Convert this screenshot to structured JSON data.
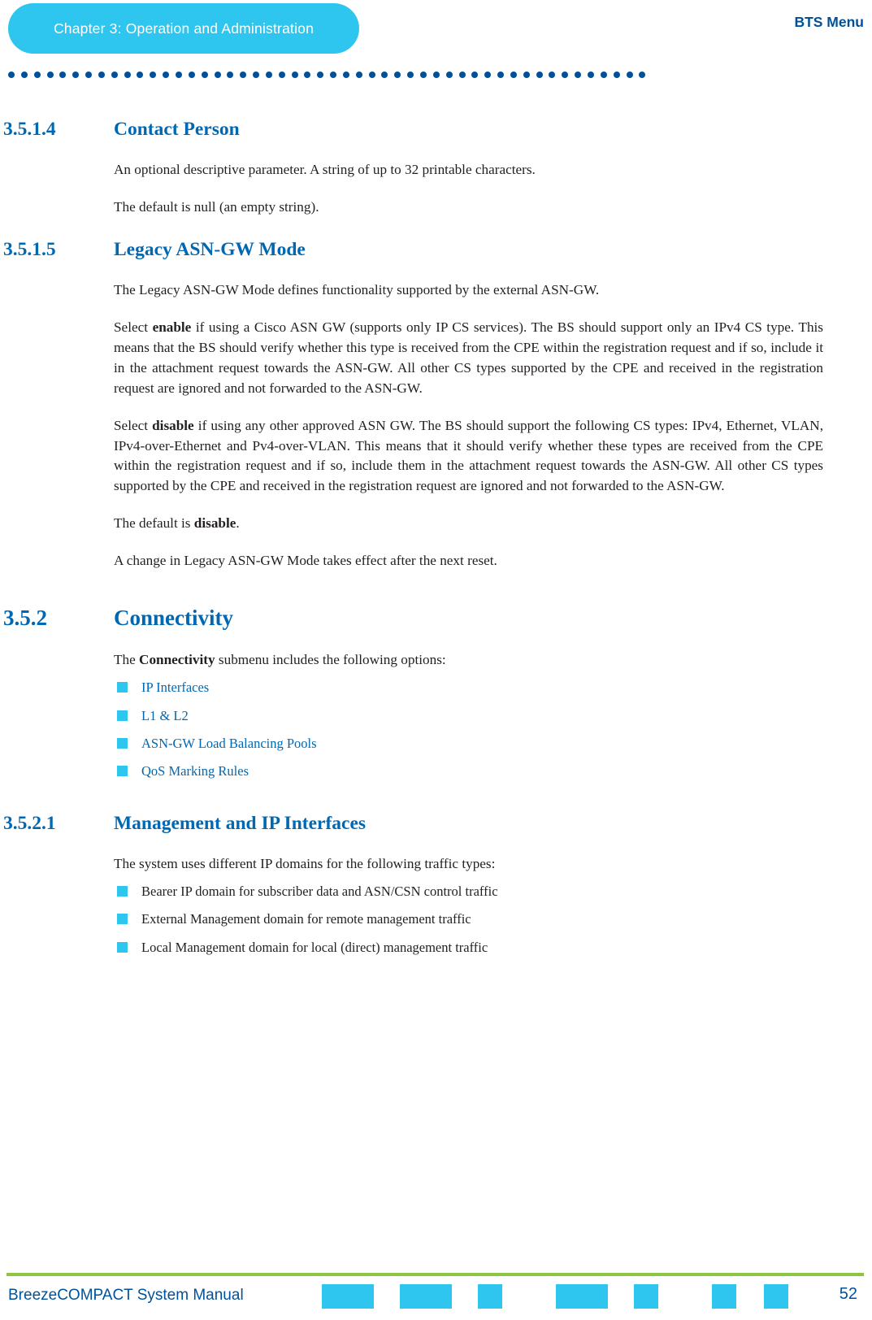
{
  "header": {
    "chapter_label": "Chapter 3: Operation and Administration",
    "right_label": "BTS Menu"
  },
  "sections": [
    {
      "number": "3.5.1.4",
      "title": "Contact Person",
      "paragraphs": [
        "An optional descriptive parameter. A string of up to 32 printable characters.",
        "The default is null (an empty string)."
      ]
    },
    {
      "number": "3.5.1.5",
      "title": "Legacy ASN-GW Mode",
      "paragraphs": [
        "The Legacy ASN-GW Mode defines functionality supported by the external ASN-GW.",
        "Select enable if using a Cisco ASN GW (supports only IP CS services). The BS should support only an IPv4 CS type. This means that the BS should verify whether this type is received from the CPE within the registration request and if so, include it in the attachment request towards the ASN-GW. All other CS types supported by the CPE and received in the registration request are ignored and not forwarded to the ASN-GW.",
        "Select disable if using any other approved ASN GW. The BS should support the following CS types: IPv4, Ethernet, VLAN, IPv4-over-Ethernet and Pv4-over-VLAN. This means that it should verify whether these types are received from the CPE within the registration request and if so, include them in the attachment request towards the ASN-GW. All other CS types supported by the CPE and received in the registration request are ignored and not forwarded to the ASN-GW.",
        "The default is disable.",
        "A change in Legacy ASN-GW Mode takes effect after the next reset."
      ]
    },
    {
      "number": "3.5.2",
      "title": "Connectivity",
      "intro": "The Connectivity submenu includes the following options:",
      "links": [
        "IP Interfaces",
        "L1 & L2",
        "ASN-GW Load Balancing Pools",
        "QoS Marking Rules"
      ]
    },
    {
      "number": "3.5.2.1",
      "title": "Management and IP Interfaces",
      "intro": "The system uses different IP domains for the following traffic types:",
      "items": [
        "Bearer IP domain for subscriber data and ASN/CSN control traffic",
        "External Management domain for remote management traffic",
        "Local Management domain for local (direct) management traffic"
      ]
    }
  ],
  "footer": {
    "manual_title": "BreezeCOMPACT System Manual",
    "page_number": "52"
  },
  "colors": {
    "accent_cyan": "#2ec5ee",
    "heading_blue": "#0068b3",
    "nav_blue": "#00519c",
    "footer_green": "#8cc63e"
  }
}
